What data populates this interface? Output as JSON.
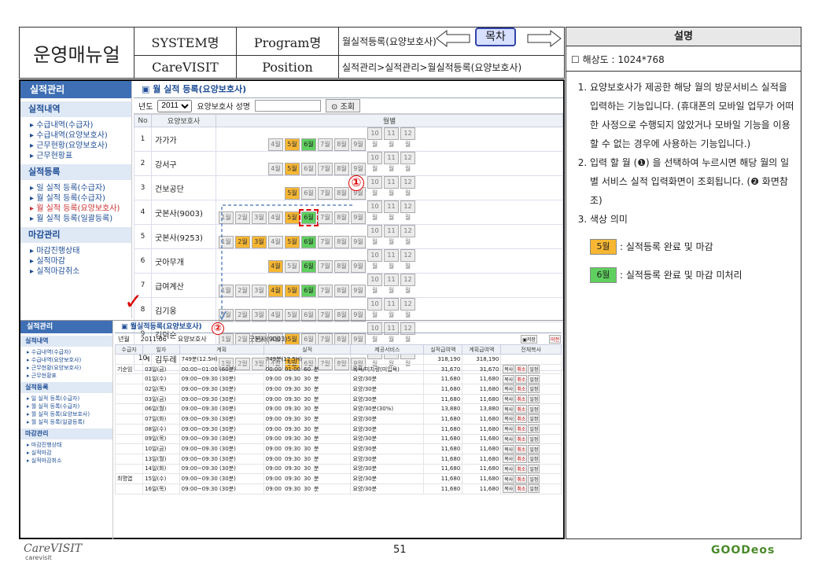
{
  "header": {
    "title": "운영매뉴얼",
    "system_label": "SYSTEM명",
    "system_value": "CareVISIT",
    "program_label": "Program명",
    "program_value": "월실적등록(요양보호사)",
    "position_label": "Position",
    "position_value": "실적관리>실적관리>월실적등록(요양보호사)",
    "toc_button": "목차"
  },
  "desc": {
    "heading": "설명",
    "resolution": "해상도 : 1024*768",
    "items": [
      "요양보호사가 제공한 해당 월의 방문서비스 실적을 입력하는 기능입니다. (휴대폰의 모바일 업무가 어떠한 사정으로 수행되지 않았거나 모바일 기능을 이용할 수 없는 경우에 사용하는 기능입니다.)",
      "입력 할 월 (❶) 을 선택하여 누르시면 해당 월의 일별 서비스 실적 입력화면이 조회됩니다. (❷ 화면참조)",
      "색상 의미"
    ],
    "legend_yellow_chip": "5월",
    "legend_yellow_text": ": 실적등록 완료 및 마감",
    "legend_green_chip": "6월",
    "legend_green_text": ": 실적등록 완료 및 마감 미처리",
    "colors": {
      "yellow": "#f7b733",
      "green": "#5fd05f"
    }
  },
  "screen1": {
    "side_header": "실적관리",
    "sec1": "실적내역",
    "sec1_items": [
      "수급내역(수급자)",
      "수급내역(요양보호사)",
      "근무현황(요양보호사)",
      "근무현황표"
    ],
    "sec2": "실적등록",
    "sec2_items": [
      "일 실적 등록(수급자)",
      "월 실적 등록(수급자)",
      "월 실적 등록(요양보호사)",
      "월 실적 등록(일괄등록)"
    ],
    "sec3": "마감관리",
    "sec3_items": [
      "마감진행상태",
      "실적마감",
      "실적마감취소"
    ],
    "content_title": "월 실적 등록(요양보호사)",
    "year_label": "년도",
    "year_value": "2011",
    "name_label": "요양보호사 성명",
    "search_button": "조회",
    "col_no": "No",
    "col_name": "요양보호사",
    "col_month": "월별",
    "rows": [
      {
        "no": "1",
        "name": "가가가",
        "m": [
          "x",
          "x",
          "x",
          "n",
          "y",
          "g",
          "n",
          "n",
          "n",
          "n",
          "n",
          "n"
        ]
      },
      {
        "no": "2",
        "name": "강서구",
        "m": [
          "x",
          "x",
          "x",
          "n",
          "y",
          "n",
          "n",
          "n",
          "n",
          "n",
          "n",
          "n"
        ]
      },
      {
        "no": "3",
        "name": "건보공단",
        "m": [
          "x",
          "x",
          "x",
          "x",
          "y",
          "n",
          "n",
          "n",
          "n",
          "n",
          "n",
          "n"
        ]
      },
      {
        "no": "4",
        "name": "굿본사(9003)",
        "m": [
          "n",
          "n",
          "n",
          "n",
          "y",
          "gs",
          "n",
          "n",
          "n",
          "n",
          "n",
          "n"
        ]
      },
      {
        "no": "5",
        "name": "굿본사(9253)",
        "m": [
          "n",
          "y",
          "y",
          "n",
          "y",
          "g",
          "n",
          "n",
          "n",
          "n",
          "n",
          "n"
        ]
      },
      {
        "no": "6",
        "name": "굿아무개",
        "m": [
          "x",
          "x",
          "x",
          "y",
          "n",
          "g",
          "n",
          "n",
          "n",
          "n",
          "n",
          "n"
        ]
      },
      {
        "no": "7",
        "name": "급여계산",
        "m": [
          "n",
          "n",
          "n",
          "y",
          "y",
          "g",
          "n",
          "n",
          "n",
          "n",
          "n",
          "n"
        ]
      },
      {
        "no": "8",
        "name": "김기웅",
        "m": [
          "n",
          "n",
          "n",
          "n",
          "n",
          "n",
          "n",
          "n",
          "n",
          "n",
          "n",
          "n"
        ]
      },
      {
        "no": "9",
        "name": "김덕순",
        "m": [
          "n",
          "n",
          "n",
          "n",
          "y",
          "n",
          "n",
          "n",
          "n",
          "n",
          "n",
          "n"
        ]
      },
      {
        "no": "10",
        "name": "김두레",
        "m": [
          "n",
          "n",
          "n",
          "n",
          "y",
          "n",
          "n",
          "n",
          "n",
          "n",
          "n",
          "n"
        ]
      }
    ],
    "months": [
      "1월",
      "2월",
      "3월",
      "4월",
      "5월",
      "6월",
      "7월",
      "8월",
      "9월",
      "10월",
      "11월",
      "12월"
    ]
  },
  "screen2": {
    "content_title": "월실적등록(요양보호사)",
    "ym_label": "년월",
    "ym_value": "2011.06",
    "worker_label": "요양보호사",
    "worker_value": "굿본사(9003)",
    "save_btn": "저장",
    "prev_btn": "이전",
    "cols": [
      "수급자",
      "일자",
      "계획",
      "실적",
      "제공서비스",
      "실적급여액",
      "계획급여액",
      "전체복사"
    ],
    "total_label": "계",
    "total_plan": "749분(12.5H)",
    "total_actual": "749분(12.5H)",
    "total_a": "318,190",
    "total_b": "318,190",
    "rows": [
      [
        "기순임",
        "03일(금)",
        "00:00~01:00 (60분)",
        "00:00",
        "01:00",
        "60",
        "분",
        "목욕/미차량(미입욕)",
        "31,670",
        "31,670"
      ],
      [
        "",
        "01일(수)",
        "09:00~09:30 (30분)",
        "09:00",
        "09:30",
        "30",
        "분",
        "요양/30분",
        "11,680",
        "11,680"
      ],
      [
        "",
        "02일(목)",
        "09:00~09:30 (30분)",
        "09:00",
        "09:30",
        "30",
        "분",
        "요양/30분",
        "11,680",
        "11,680"
      ],
      [
        "",
        "03일(금)",
        "09:00~09:30 (30분)",
        "09:00",
        "09:30",
        "30",
        "분",
        "요양/30분",
        "11,680",
        "11,680"
      ],
      [
        "",
        "06일(월)",
        "09:00~09:30 (30분)",
        "09:00",
        "09:30",
        "30",
        "분",
        "요양/30분(30%)",
        "13,880",
        "13,880"
      ],
      [
        "",
        "07일(화)",
        "09:00~09:30 (30분)",
        "09:00",
        "09:30",
        "30",
        "분",
        "요양/30분",
        "11,680",
        "11,680"
      ],
      [
        "",
        "08일(수)",
        "09:00~09:30 (30분)",
        "09:00",
        "09:30",
        "30",
        "분",
        "요양/30분",
        "11,680",
        "11,680"
      ],
      [
        "",
        "09일(목)",
        "09:00~09:30 (30분)",
        "09:00",
        "09:30",
        "30",
        "분",
        "요양/30분",
        "11,680",
        "11,680"
      ],
      [
        "",
        "10일(금)",
        "09:00~09:30 (30분)",
        "09:00",
        "09:30",
        "30",
        "분",
        "요양/30분",
        "11,680",
        "11,680"
      ],
      [
        "",
        "13일(월)",
        "09:00~09:30 (30분)",
        "09:00",
        "09:30",
        "30",
        "분",
        "요양/30분",
        "11,680",
        "11,680"
      ],
      [
        "",
        "14일(화)",
        "09:00~09:30 (30분)",
        "09:00",
        "09:30",
        "30",
        "분",
        "요양/30분",
        "11,680",
        "11,680"
      ],
      [
        "최명엽",
        "15일(수)",
        "09:00~09:30 (30분)",
        "09:00",
        "09:30",
        "30",
        "분",
        "요양/30분",
        "11,680",
        "11,680"
      ],
      [
        "",
        "16일(목)",
        "09:00~09:30 (30분)",
        "09:00",
        "09:30",
        "30",
        "분",
        "요양/30분",
        "11,680",
        "11,680"
      ]
    ],
    "row_tags": [
      "복사",
      "취소",
      "일정"
    ]
  },
  "markers": {
    "one": "①",
    "two": "②"
  },
  "footer": {
    "logo": "CareVISIT",
    "logo_sub": "carevisit",
    "page": "51",
    "right_logo": "GOODeos"
  }
}
